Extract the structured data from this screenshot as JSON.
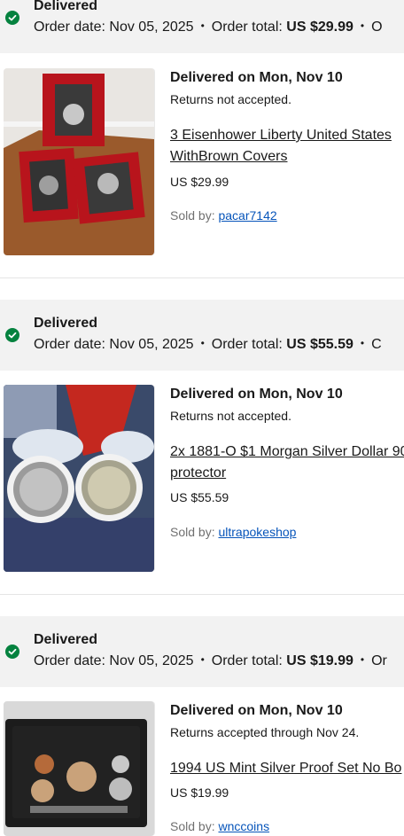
{
  "orders": [
    {
      "status": "Delivered",
      "order_date_label": "Order date:",
      "order_date": "Nov 05, 2025",
      "order_total_label": "Order total:",
      "order_total": "US $29.99",
      "overflow": "O",
      "delivered_on": "Delivered on Mon, Nov 10",
      "returns": "Returns not accepted.",
      "title_line1": "3 Eisenhower Liberty United States",
      "title_line2": "WithBrown Covers",
      "price": "US $29.99",
      "sold_by_label": "Sold by:",
      "seller": "pacar7142"
    },
    {
      "status": "Delivered",
      "order_date_label": "Order date:",
      "order_date": "Nov 05, 2025",
      "order_total_label": "Order total:",
      "order_total": "US $55.59",
      "overflow": "C",
      "delivered_on": "Delivered on Mon, Nov 10",
      "returns": "Returns not accepted.",
      "title_line1": "2x 1881-O $1 Morgan Silver Dollar 90",
      "title_line2": "protector",
      "price": "US $55.59",
      "sold_by_label": "Sold by:",
      "seller": "ultrapokeshop"
    },
    {
      "status": "Delivered",
      "order_date_label": "Order date:",
      "order_date": "Nov 05, 2025",
      "order_total_label": "Order total:",
      "order_total": "US $19.99",
      "overflow": "Or",
      "delivered_on": "Delivered on Mon, Nov 10",
      "returns": "Returns accepted through Nov 24.",
      "title_line1": "1994 US Mint Silver Proof Set No Bo",
      "title_line2": "",
      "price": "US $19.99",
      "sold_by_label": "Sold by:",
      "seller": "wnccoins"
    }
  ],
  "colors": {
    "check": "#05823f",
    "link": "#0654ba",
    "header_bg": "#f2f2f2"
  }
}
